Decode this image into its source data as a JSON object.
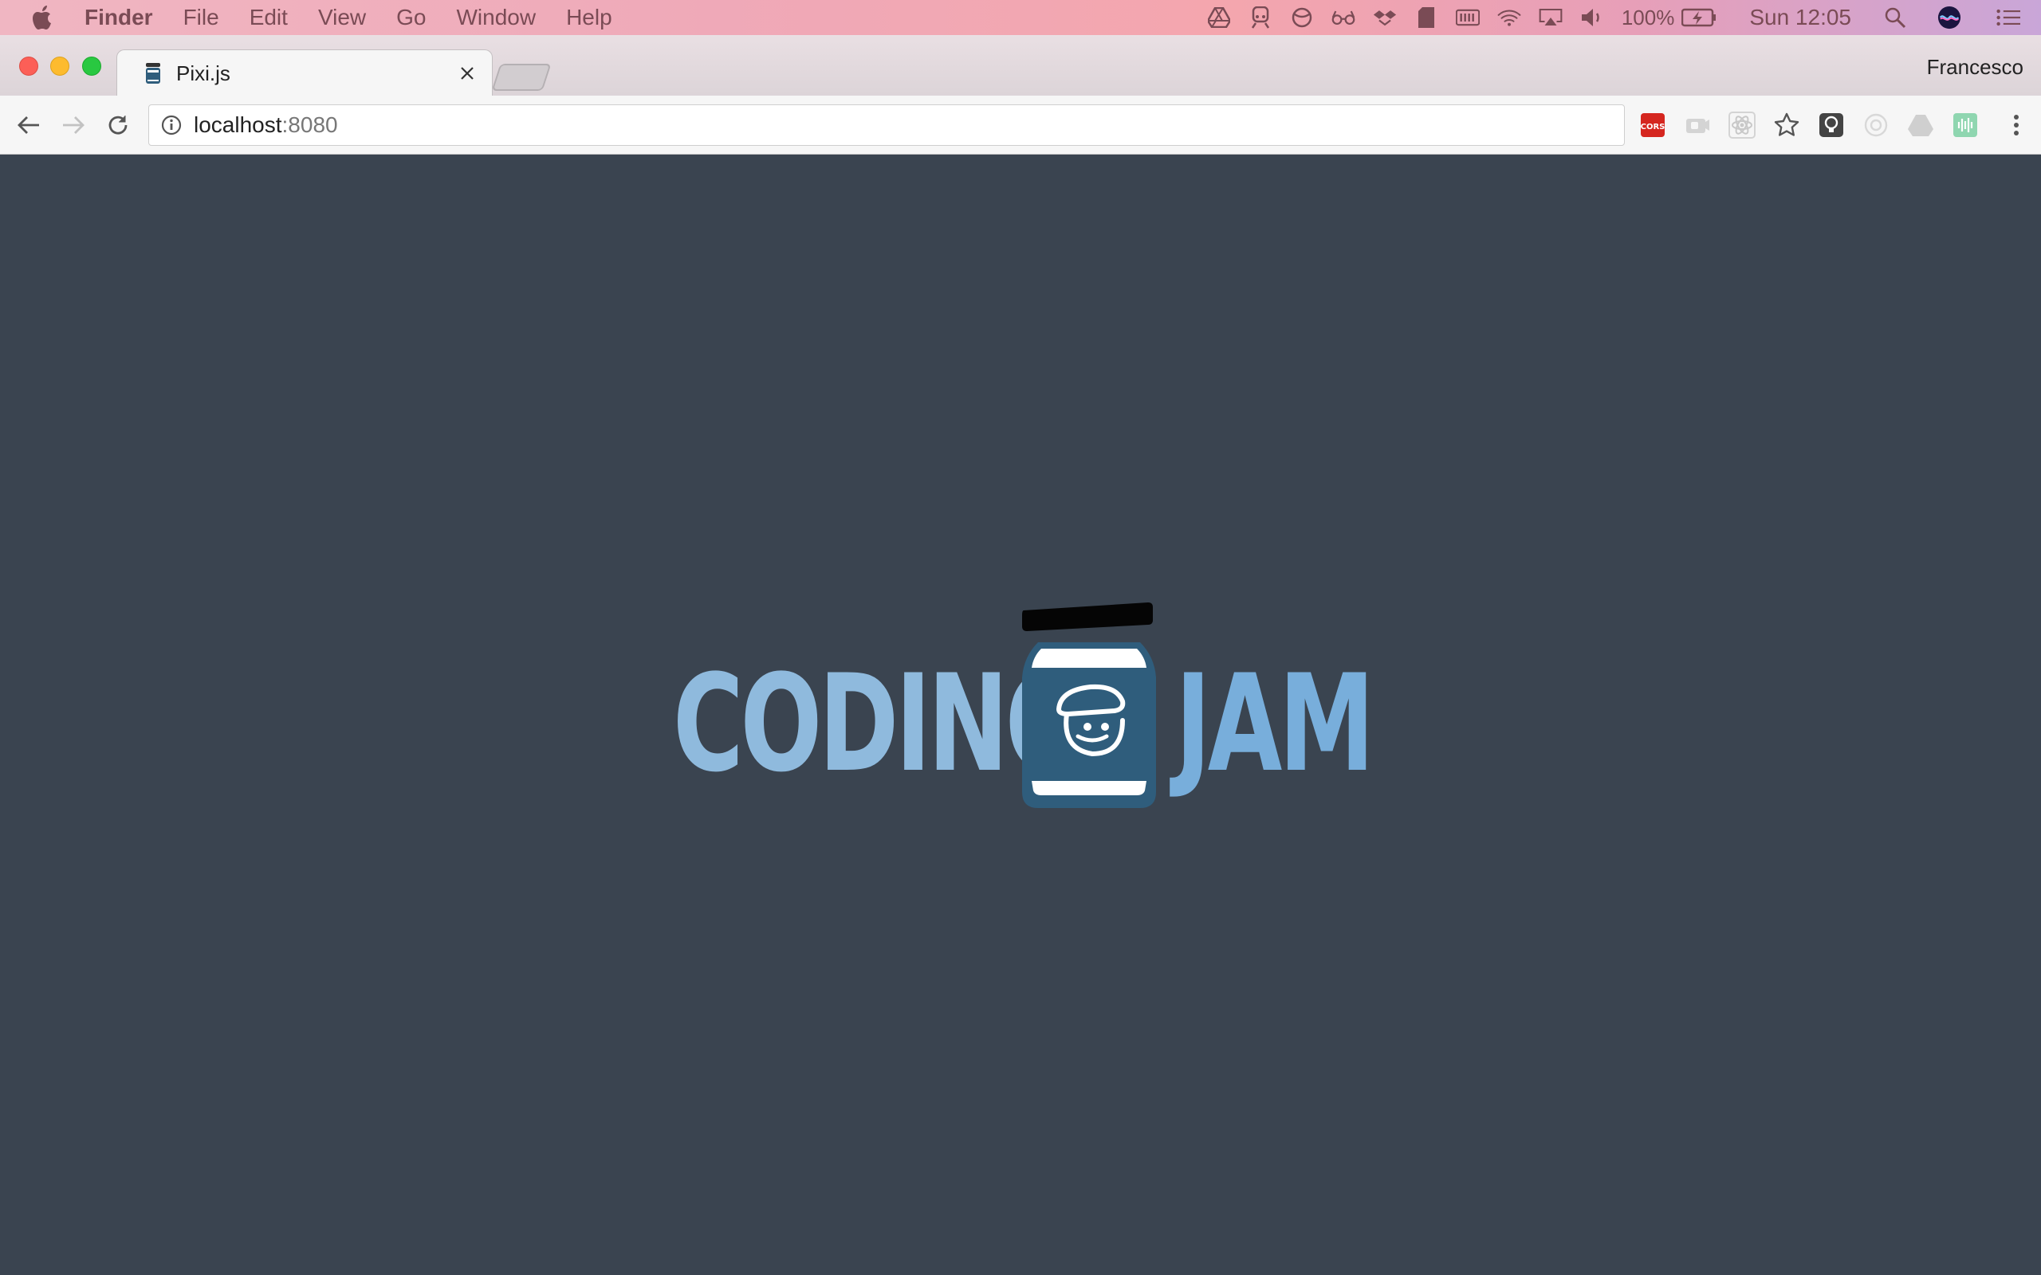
{
  "menubar": {
    "app_name": "Finder",
    "items": [
      "File",
      "Edit",
      "View",
      "Go",
      "Window",
      "Help"
    ],
    "battery_percent": "100%",
    "clock": "Sun 12:05",
    "tray_icons": [
      "google-drive-icon",
      "train-icon",
      "circle-icon",
      "glasses-icon",
      "dropbox-icon",
      "sd-card-icon",
      "battery-widget-icon",
      "wifi-icon",
      "airplay-icon",
      "volume-icon"
    ]
  },
  "browser": {
    "tab_title": "Pixi.js",
    "profile_name": "Francesco",
    "address": {
      "host": "localhost",
      "port": ":8080"
    },
    "extensions": [
      "cors-extension-icon",
      "camera-extension-icon",
      "react-extension-icon",
      "bookmark-star-icon",
      "lightbulb-extension-icon",
      "circle-extension-icon",
      "drive-extension-icon",
      "audio-extension-icon"
    ]
  },
  "page": {
    "logo": {
      "left_word": "CODING",
      "right_word": "JAM"
    },
    "colors": {
      "background": "#3a4450",
      "logo_left": "#8fbadd",
      "logo_right": "#78aedb",
      "jar_body": "#2f5d7c"
    }
  }
}
